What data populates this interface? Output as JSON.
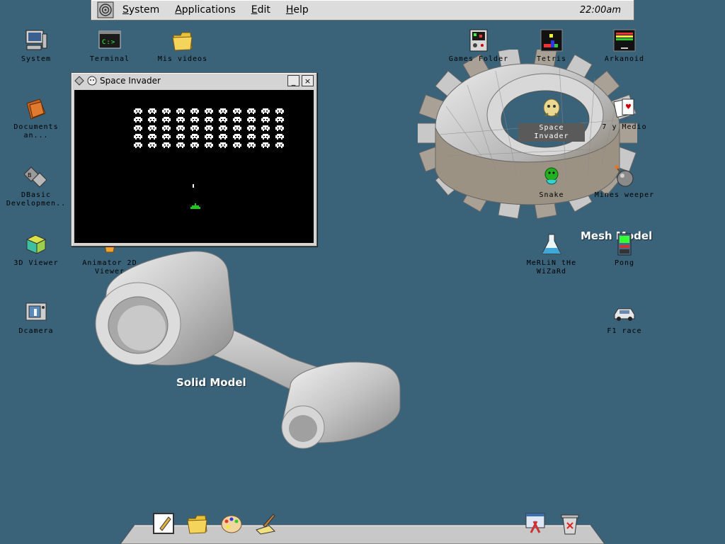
{
  "menubar": {
    "menus": [
      "System",
      "Applications",
      "Edit",
      "Help"
    ],
    "clock": "22:00am"
  },
  "desktop_icons_left": [
    {
      "name": "system",
      "label": "System",
      "icon": "computer-icon"
    },
    {
      "name": "terminal",
      "label": "Terminal",
      "icon": "terminal-icon"
    },
    {
      "name": "mis-videos",
      "label": "Mis videos",
      "icon": "folder-icon"
    },
    {
      "name": "documents",
      "label": "Documents\nan...",
      "icon": "folder-icon"
    },
    {
      "name": "dbasic",
      "label": "DBasic\nDevelopmen..",
      "icon": "dbasic-icon"
    },
    {
      "name": "3d-viewer",
      "label": "3D Viewer",
      "icon": "cube-icon"
    },
    {
      "name": "animator",
      "label": "Animator 2D\nViewer",
      "icon": "animator-icon"
    },
    {
      "name": "dcamera",
      "label": "Dcamera",
      "icon": "camera-icon"
    }
  ],
  "desktop_icons_right": [
    {
      "name": "games-folder",
      "label": "Games Folder",
      "icon": "games-folder-icon"
    },
    {
      "name": "tetris",
      "label": "Tetris",
      "icon": "tetris-icon"
    },
    {
      "name": "arkanoid",
      "label": "Arkanoid",
      "icon": "arkanoid-icon"
    },
    {
      "name": "space-invader",
      "label": "Space\nInvader",
      "icon": "invader-icon"
    },
    {
      "name": "7-y-medio",
      "label": "7 y Medio",
      "icon": "cards-icon"
    },
    {
      "name": "snake",
      "label": "Snake",
      "icon": "snake-icon"
    },
    {
      "name": "mines-weeper",
      "label": "Mines weeper",
      "icon": "bomb-icon"
    },
    {
      "name": "merlin",
      "label": "MeRLiN tHe\nWiZaRd",
      "icon": "flask-icon"
    },
    {
      "name": "pong",
      "label": "Pong",
      "icon": "arcade-icon"
    },
    {
      "name": "f1-race",
      "label": "F1 race",
      "icon": "car-icon"
    }
  ],
  "models": {
    "solid_label": "Solid Model",
    "mesh_label": "Mesh Model"
  },
  "window": {
    "title": "Space Invader",
    "minimize": "_",
    "close": "×"
  },
  "dock": [
    "notepad-icon",
    "folder-icon",
    "palette-icon",
    "paint-icon",
    "tools-icon",
    "trash-icon"
  ],
  "colors": {
    "desktop": "#3a6278",
    "invader": "#ffffff",
    "player": "#22c522"
  }
}
